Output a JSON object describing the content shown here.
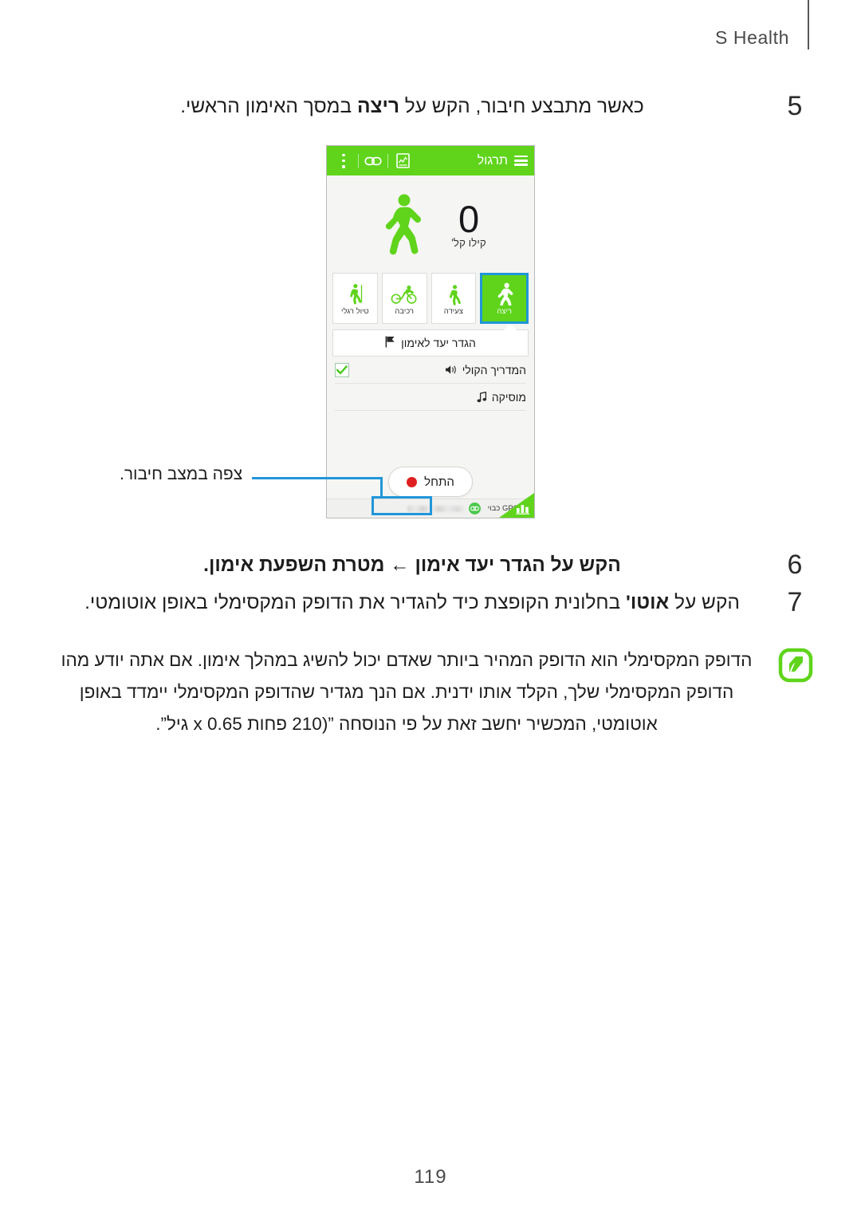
{
  "header": {
    "title": "S Health"
  },
  "steps": [
    {
      "number": "5",
      "pre": "כאשר מתבצע חיבור, הקש על ",
      "bold": "ריצה",
      "post": " במסך האימון הראשי."
    },
    {
      "number": "6",
      "pre": "הקש על ",
      "bold": "הגדר יעד אימון ← מטרת השפעת אימון",
      "post": "."
    },
    {
      "number": "7",
      "pre": "הקש על ",
      "bold": "אוטו'",
      "post": " בחלונית הקופצת כיד להגדיר את הדופק המקסימלי באופן אוטומטי."
    }
  ],
  "phone": {
    "topbar": {
      "menu_icon": "hamburger-icon",
      "title": "תרגול",
      "log_icon": "log-chart-icon",
      "link_icon": "link-icon",
      "overflow_icon": "more-vertical-icon"
    },
    "hero": {
      "runner_icon": "running-person-icon",
      "value": "0",
      "unit": "קילו קל'"
    },
    "activities": [
      {
        "label": "ריצה",
        "icon": "running-icon",
        "selected": true
      },
      {
        "label": "צעידה",
        "icon": "walking-icon",
        "selected": false
      },
      {
        "label": "רכיבה",
        "icon": "cycling-icon",
        "selected": false
      },
      {
        "label": "טיול רגלי",
        "icon": "hiking-icon",
        "selected": false
      }
    ],
    "goal_row": {
      "icon": "flag-icon",
      "label": "הגדר יעד לאימון"
    },
    "options": [
      {
        "label": "המדריך הקולי",
        "icon": "speaker-icon",
        "checked": true
      },
      {
        "label": "מוסיקה",
        "icon": "music-note-icon",
        "checked": false
      }
    ],
    "start_button": {
      "label": "התחל",
      "icon": "record-dot-icon"
    },
    "statusbar": {
      "gps_icon": "gps-target-icon",
      "gps_label": "GPS כבוי",
      "device_icon": "device-connected-icon",
      "device_name": "",
      "graph_icon": "bar-chart-icon"
    }
  },
  "callout": {
    "text": "צפה במצב חיבור."
  },
  "note": {
    "icon": "samsung-note-icon",
    "text": "הדופק המקסימלי הוא הדופק המהיר ביותר שאדם יכול להשיג במהלך אימון. אם אתה יודע מהו הדופק המקסימלי שלך, הקלד אותו ידנית. אם הנך מגדיר שהדופק המקסימלי יימדד באופן אוטומטי, המכשיר יחשב זאת על פי הנוסחה ”(210 פחות 0.65 x גיל”."
  },
  "footer": {
    "page_number": "119"
  },
  "colors": {
    "brand_green": "#5fd41b",
    "highlight_blue": "#2196d9",
    "record_red": "#e02020",
    "note_green": "#5fd41b"
  }
}
